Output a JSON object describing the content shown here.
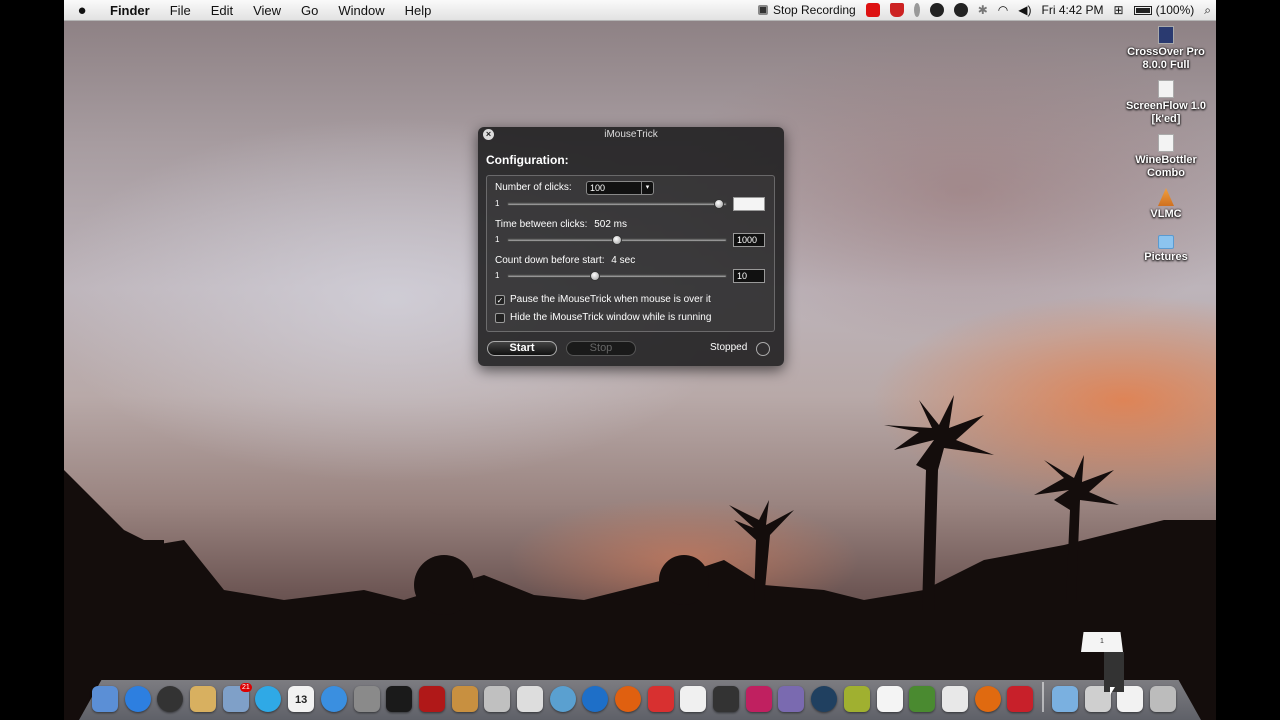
{
  "menubar": {
    "app_name": "Finder",
    "menus": [
      "File",
      "Edit",
      "View",
      "Go",
      "Window",
      "Help"
    ],
    "stop_recording": "Stop Recording",
    "clock": "Fri 4:42 PM",
    "battery": "(100%)"
  },
  "desktop_icons": [
    {
      "label": "CrossOver Pro 8.0.0 Full",
      "icon": "crossover-icon"
    },
    {
      "label": "ScreenFlow 1.0 [k'ed]",
      "icon": "document-icon"
    },
    {
      "label": "WineBottler Combo",
      "icon": "document-icon"
    },
    {
      "label": "VLMC",
      "icon": "vlc-cone-icon"
    },
    {
      "label": "Pictures",
      "icon": "folder-icon"
    }
  ],
  "window": {
    "title": "iMouseTrick",
    "heading": "Configuration:",
    "clicks": {
      "label": "Number of clicks:",
      "value": "100",
      "slider_min": "1",
      "slider_level": 0.97,
      "field_value": ""
    },
    "interval": {
      "label": "Time between clicks:",
      "readout": "502 ms",
      "slider_min": "1",
      "slider_level": 0.5,
      "field_value": "1000"
    },
    "countdown": {
      "label": "Count down before start:",
      "readout": "4 sec",
      "slider_min": "1",
      "slider_level": 0.4,
      "field_value": "10"
    },
    "checkbox_pause": {
      "label": "Pause the iMouseTrick when mouse is over it",
      "checked": true,
      "mark": "✓"
    },
    "checkbox_hide": {
      "label": "Hide the iMouseTrick window while is running",
      "checked": false
    },
    "start_label": "Start",
    "stop_label": "Stop",
    "status_text": "Stopped"
  },
  "dock": {
    "apps": [
      {
        "name": "finder-icon",
        "color": "#5b8fd6"
      },
      {
        "name": "app-store-icon",
        "color": "#2d7fe0"
      },
      {
        "name": "dashboard-icon",
        "color": "#333333"
      },
      {
        "name": "contacts-icon",
        "color": "#d8b060"
      },
      {
        "name": "mail-icon",
        "color": "#7fa0c8",
        "badge": "21"
      },
      {
        "name": "skype-icon",
        "color": "#2fa9e6"
      },
      {
        "name": "calendar-icon",
        "color": "#f2f2f2",
        "text": "13"
      },
      {
        "name": "itunes-icon",
        "color": "#3a8fe0"
      },
      {
        "name": "system-preferences-icon",
        "color": "#8a8a8a"
      },
      {
        "name": "terminal-icon",
        "color": "#1a1a1a"
      },
      {
        "name": "photo-booth-icon",
        "color": "#b01818"
      },
      {
        "name": "garageband-icon",
        "color": "#c89040"
      },
      {
        "name": "facetime-icon",
        "color": "#c0c0c0"
      },
      {
        "name": "calculator-icon",
        "color": "#dddddd"
      },
      {
        "name": "adium-icon",
        "color": "#5aa0d0"
      },
      {
        "name": "quicktime-icon",
        "color": "#1e6fc8"
      },
      {
        "name": "burn-icon",
        "color": "#e06010"
      },
      {
        "name": "warning-icon",
        "color": "#d83030"
      },
      {
        "name": "mouse-icon",
        "color": "#f0f0f0"
      },
      {
        "name": "screen-icon",
        "color": "#333333"
      },
      {
        "name": "star-app-icon",
        "color": "#c02060"
      },
      {
        "name": "pencil-app-icon",
        "color": "#7a6ab0"
      },
      {
        "name": "moon-icon",
        "color": "#204060"
      },
      {
        "name": "ninja-star-icon",
        "color": "#a0b030"
      },
      {
        "name": "notes-icon",
        "color": "#f4f4f4"
      },
      {
        "name": "minecraft-icon",
        "color": "#4a8a30"
      },
      {
        "name": "script-icon",
        "color": "#e8e8e8"
      },
      {
        "name": "firefox-icon",
        "color": "#e06a10"
      },
      {
        "name": "sbp-icon",
        "color": "#c8202a"
      }
    ],
    "stacks": [
      {
        "name": "applications-folder-icon",
        "color": "#7ab0e0"
      },
      {
        "name": "documents-stack-icon",
        "color": "#cfcfcf"
      },
      {
        "name": "downloads-stack-icon",
        "color": "#f2f2f2"
      },
      {
        "name": "trash-icon",
        "color": "#bcbcbc"
      }
    ],
    "stack_card_label": "1"
  }
}
